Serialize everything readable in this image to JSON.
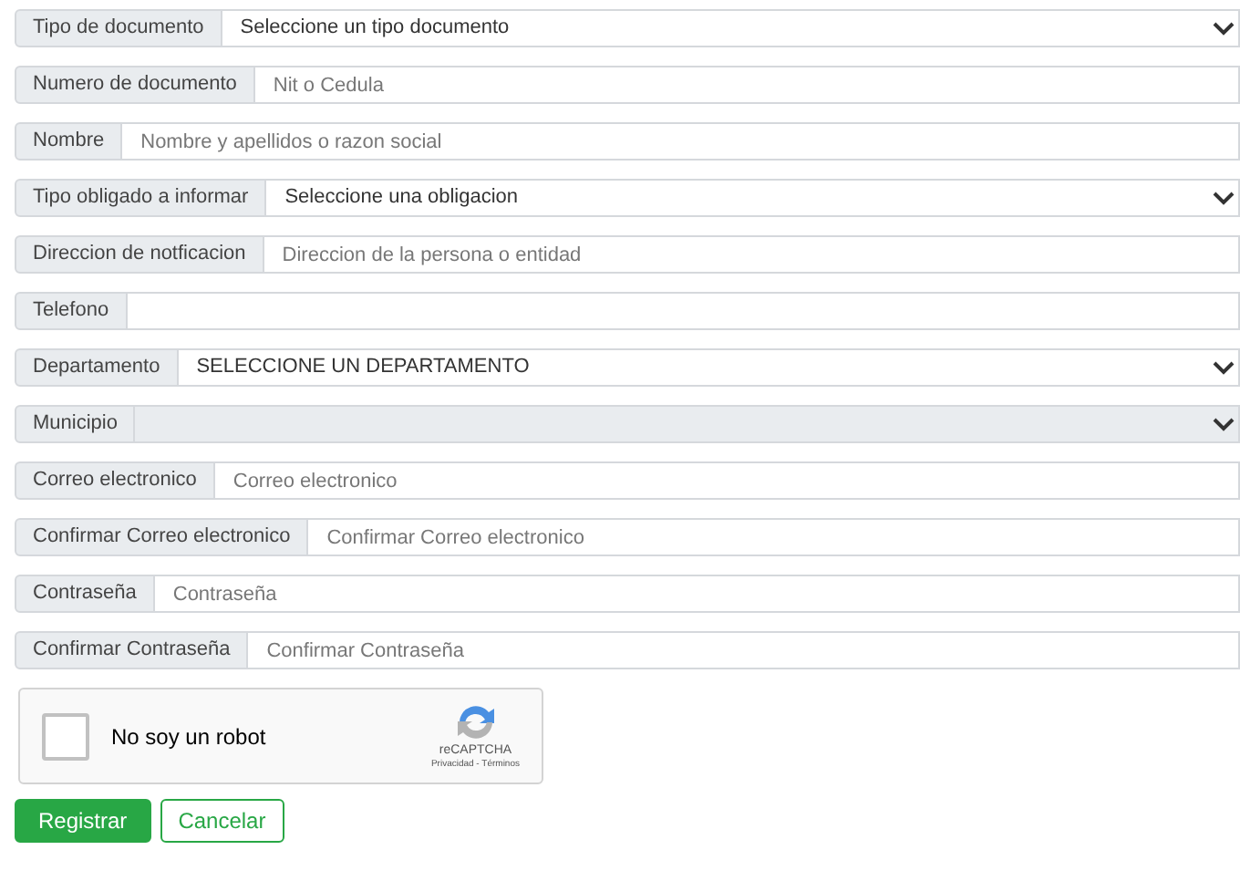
{
  "fields": [
    {
      "kind": "select",
      "label": "Tipo de documento",
      "value": "Seleccione un tipo documento",
      "disabled": false
    },
    {
      "kind": "text",
      "label": "Numero de documento",
      "placeholder": "Nit o Cedula"
    },
    {
      "kind": "text",
      "label": "Nombre",
      "placeholder": "Nombre y apellidos o razon social"
    },
    {
      "kind": "select",
      "label": "Tipo obligado a informar",
      "value": "Seleccione una obligacion",
      "disabled": false
    },
    {
      "kind": "text",
      "label": "Direccion de notficacion",
      "placeholder": "Direccion de la persona o entidad"
    },
    {
      "kind": "text",
      "label": "Telefono"
    },
    {
      "kind": "select",
      "label": "Departamento",
      "value": "SELECCIONE UN DEPARTAMENTO",
      "disabled": false
    },
    {
      "kind": "select",
      "label": "Municipio",
      "disabled": true
    },
    {
      "kind": "text",
      "label": "Correo electronico",
      "placeholder": "Correo electronico"
    },
    {
      "kind": "text",
      "label": "Confirmar Correo electronico",
      "placeholder": "Confirmar Correo electronico"
    },
    {
      "kind": "text",
      "label": "Contraseña",
      "placeholder": "Contraseña"
    },
    {
      "kind": "text",
      "label": "Confirmar Contraseña",
      "placeholder": "Confirmar Contraseña"
    }
  ],
  "captcha": {
    "label": "No soy un robot",
    "checked": false,
    "brand": "reCAPTCHA",
    "links": "Privacidad - Términos"
  },
  "buttons": [
    {
      "label": "Registrar",
      "kind": "primary"
    },
    {
      "label": "Cancelar",
      "kind": "secondary"
    }
  ]
}
